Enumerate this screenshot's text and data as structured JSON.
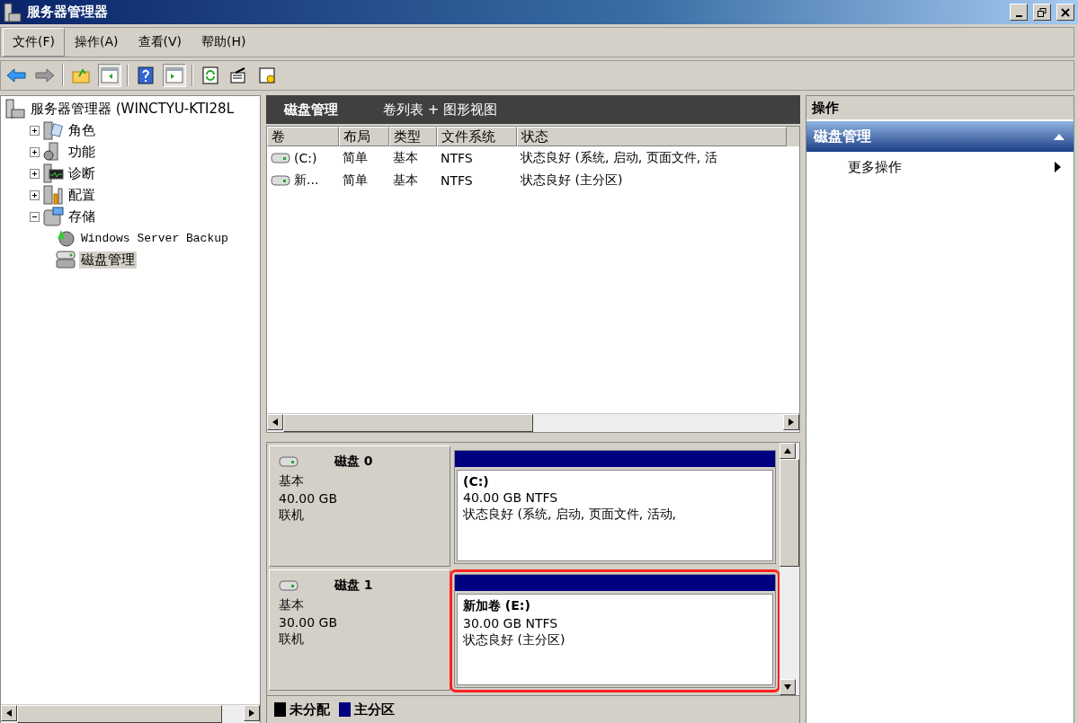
{
  "window": {
    "title": "服务器管理器"
  },
  "menu": [
    {
      "label": "文件(F)",
      "selected": true
    },
    {
      "label": "操作(A)",
      "selected": false
    },
    {
      "label": "查看(V)",
      "selected": false
    },
    {
      "label": "帮助(H)",
      "selected": false
    }
  ],
  "tree": {
    "label": "服务器管理器 (WINCTYU-KTI28L",
    "children": [
      {
        "label": "角色",
        "kind": "roles",
        "expanded": false,
        "selected": false
      },
      {
        "label": "功能",
        "kind": "features",
        "expanded": false,
        "selected": false
      },
      {
        "label": "诊断",
        "kind": "diagnostics",
        "expanded": false,
        "selected": false
      },
      {
        "label": "配置",
        "kind": "config",
        "expanded": false,
        "selected": false
      },
      {
        "label": "存储",
        "kind": "storage",
        "expanded": true,
        "selected": false,
        "children": [
          {
            "label": "Windows Server Backup",
            "kind": "backup",
            "selected": false
          },
          {
            "label": "磁盘管理",
            "kind": "disk",
            "selected": true
          }
        ]
      }
    ]
  },
  "center": {
    "title": "磁盘管理",
    "subtitle": "卷列表 + 图形视图"
  },
  "table": {
    "columns": [
      "卷",
      "布局",
      "类型",
      "文件系统",
      "状态"
    ],
    "rows": [
      [
        "(C:)",
        "简单",
        "基本",
        "NTFS",
        "状态良好 (系统, 启动, 页面文件, 活"
      ],
      [
        "新...",
        "简单",
        "基本",
        "NTFS",
        "状态良好 (主分区)"
      ]
    ]
  },
  "disks": [
    {
      "name": "磁盘 0",
      "type": "基本",
      "size": "40.00 GB",
      "status": "联机",
      "partitions": [
        {
          "name": "(C:)",
          "size": "40.00 GB NTFS",
          "status": "状态良好 (系统, 启动, 页面文件, 活动,",
          "highlighted": false
        }
      ]
    },
    {
      "name": "磁盘 1",
      "type": "基本",
      "size": "30.00 GB",
      "status": "联机",
      "partitions": [
        {
          "name": "新加卷  (E:)",
          "size": "30.00 GB NTFS",
          "status": "状态良好 (主分区)",
          "highlighted": true
        }
      ]
    }
  ],
  "legend": [
    {
      "label": "未分配",
      "color": "#000000"
    },
    {
      "label": "主分区",
      "color": "#000080"
    }
  ],
  "actions": {
    "title": "操作",
    "section": "磁盘管理",
    "items": [
      "更多操作"
    ]
  }
}
